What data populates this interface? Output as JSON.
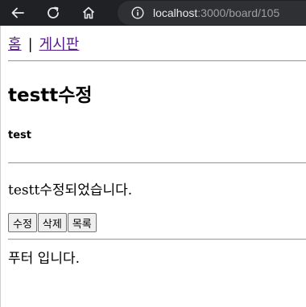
{
  "browser": {
    "url_host": "localhost",
    "url_rest": ":3000/board/105",
    "icons": [
      "back-icon",
      "reload-icon",
      "home-icon",
      "info-icon"
    ]
  },
  "nav": {
    "home_label": "홈",
    "separator": "|",
    "board_label": "게시판"
  },
  "post": {
    "title": "testt수정",
    "author": "test",
    "content": "testt수정되었습니다."
  },
  "actions": {
    "edit_label": "수정",
    "delete_label": "삭제",
    "list_label": "목록"
  },
  "footer": {
    "text": "푸터 입니다."
  },
  "colors": {
    "chrome_bg": "#202124",
    "omnibox_bg": "#2f3033",
    "link": "#551a8b"
  }
}
